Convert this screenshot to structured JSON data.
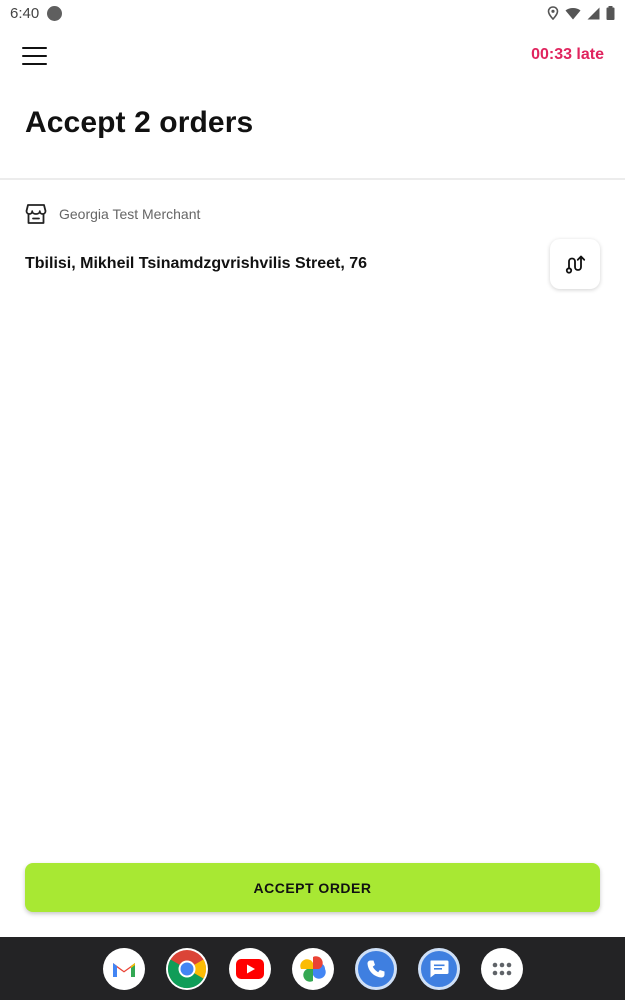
{
  "status_bar": {
    "time": "6:40"
  },
  "header": {
    "late_label": "00:33 late"
  },
  "page": {
    "title": "Accept 2 orders"
  },
  "order": {
    "merchant_name": "Georgia Test Merchant",
    "address": "Tbilisi, Mikheil Tsinamdzgvrishvilis Street, 76"
  },
  "actions": {
    "accept_label": "ACCEPT ORDER"
  },
  "colors": {
    "accent_late": "#e0245e",
    "accept_button": "#a8e833",
    "nav_bar": "#232325"
  },
  "dock": {
    "apps": [
      "gmail-icon",
      "chrome-icon",
      "youtube-icon",
      "photos-icon",
      "phone-icon",
      "messages-icon",
      "app-drawer-icon"
    ]
  }
}
